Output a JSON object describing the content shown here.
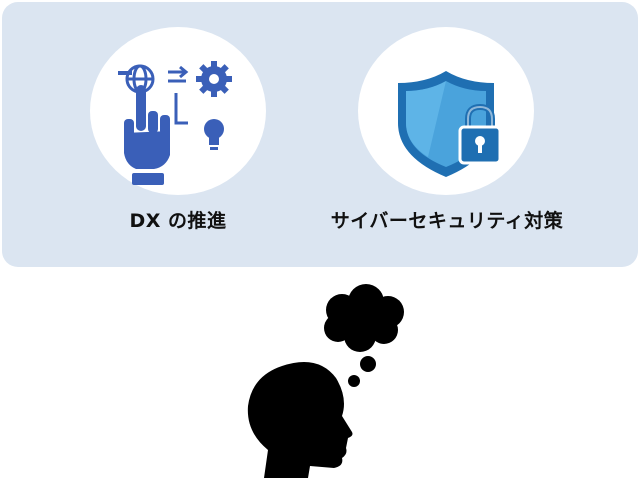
{
  "topics": [
    {
      "label": "DX の推進",
      "icon": "digital-transformation-icon"
    },
    {
      "label": "サイバーセキュリティ対策",
      "icon": "shield-lock-icon"
    }
  ],
  "thinker": {
    "icon": "thinking-head-icon"
  },
  "colors": {
    "panel": "#dbe5f1",
    "dx_icon": "#3a5fb8",
    "shield": "#4aa3dc",
    "shield_dark": "#1f6fb2",
    "silhouette": "#000000"
  }
}
